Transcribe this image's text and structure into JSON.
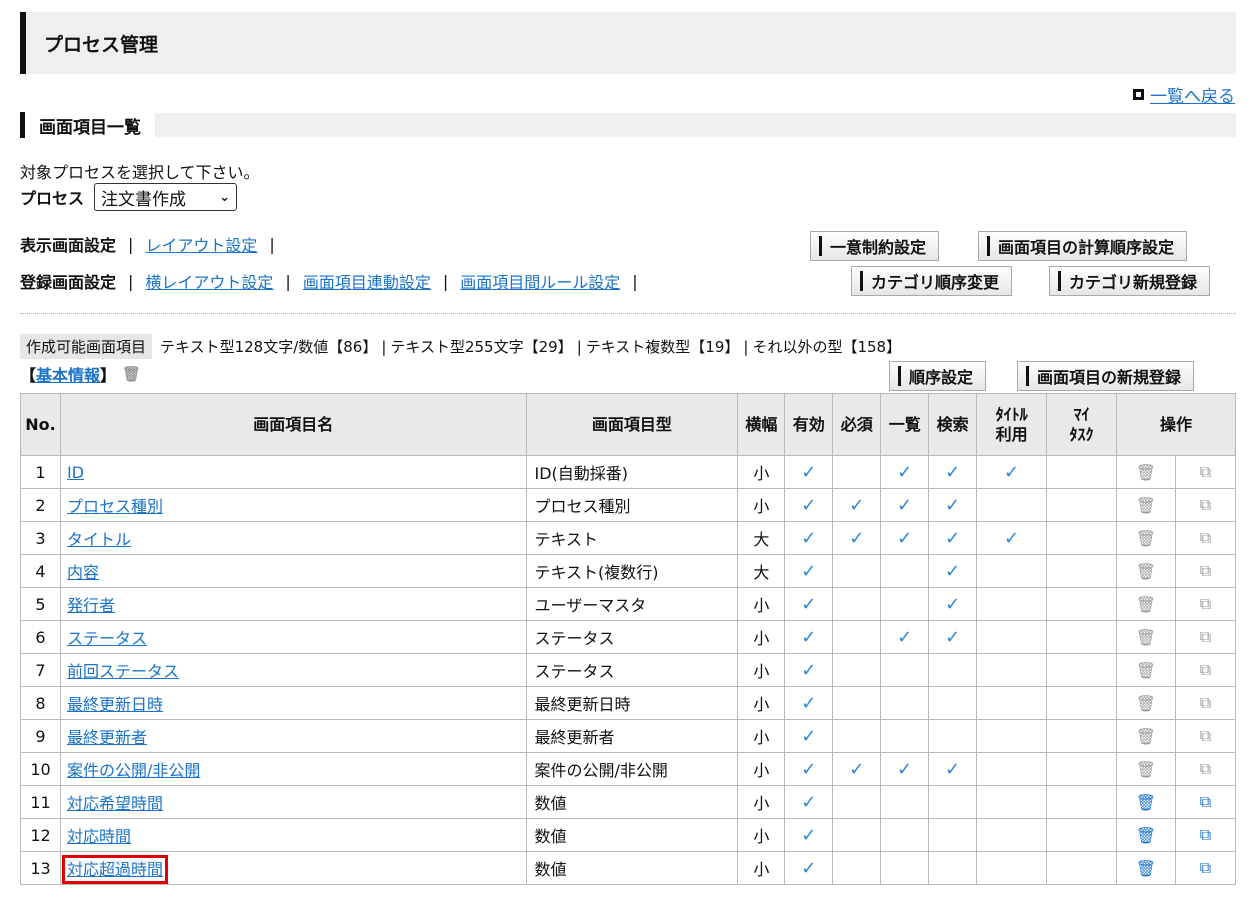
{
  "header": {
    "title": "プロセス管理"
  },
  "back_link": "一覧へ戻る",
  "section": {
    "title": "画面項目一覧"
  },
  "instruction": "対象プロセスを選択して下さい。",
  "process": {
    "label": "プロセス",
    "selected": "注文書作成"
  },
  "display_settings": {
    "label": "表示画面設定",
    "links": [
      "レイアウト設定"
    ]
  },
  "register_settings": {
    "label": "登録画面設定",
    "links": [
      "横レイアウト設定",
      "画面項目連動設定",
      "画面項目間ルール設定"
    ]
  },
  "separator": "|",
  "buttons": {
    "unique": "一意制約設定",
    "calc_order": "画面項目の計算順序設定",
    "cat_order": "カテゴリ順序変更",
    "cat_new": "カテゴリ新規登録",
    "order": "順序設定",
    "item_new": "画面項目の新規登録"
  },
  "counts": {
    "label": "作成可能画面項目",
    "items": [
      "テキスト型128文字/数値【86】",
      "テキスト型255文字【29】",
      "テキスト複数型【19】",
      "それ以外の型【158】"
    ]
  },
  "category": {
    "open": "【",
    "name": "基本情報",
    "close": "】"
  },
  "table": {
    "headers": {
      "no": "No.",
      "name": "画面項目名",
      "type": "画面項目型",
      "width": "横幅",
      "valid": "有効",
      "required": "必須",
      "list": "一覧",
      "search": "検索",
      "title1": "ﾀｲﾄﾙ",
      "title2": "利用",
      "my1": "ﾏｲ",
      "my2": "ﾀｽｸ",
      "ops": "操作"
    },
    "check_mark": "✓",
    "trash_icon": "trash-icon",
    "copy_icon": "copy-icon",
    "rows": [
      {
        "no": "1",
        "name": "ID",
        "type": "ID(自動採番)",
        "width": "小",
        "valid": true,
        "required": false,
        "list": true,
        "search": true,
        "title": true,
        "ops_active": false
      },
      {
        "no": "2",
        "name": "プロセス種別",
        "type": "プロセス種別",
        "width": "小",
        "valid": true,
        "required": true,
        "list": true,
        "search": true,
        "title": false,
        "ops_active": false
      },
      {
        "no": "3",
        "name": "タイトル",
        "type": "テキスト",
        "width": "大",
        "valid": true,
        "required": true,
        "list": true,
        "search": true,
        "title": true,
        "ops_active": false
      },
      {
        "no": "4",
        "name": "内容",
        "type": "テキスト(複数行)",
        "width": "大",
        "valid": true,
        "required": false,
        "list": false,
        "search": true,
        "title": false,
        "ops_active": false
      },
      {
        "no": "5",
        "name": "発行者",
        "type": "ユーザーマスタ",
        "width": "小",
        "valid": true,
        "required": false,
        "list": false,
        "search": true,
        "title": false,
        "ops_active": false
      },
      {
        "no": "6",
        "name": "ステータス",
        "type": "ステータス",
        "width": "小",
        "valid": true,
        "required": false,
        "list": true,
        "search": true,
        "title": false,
        "ops_active": false
      },
      {
        "no": "7",
        "name": "前回ステータス",
        "type": "ステータス",
        "width": "小",
        "valid": true,
        "required": false,
        "list": false,
        "search": false,
        "title": false,
        "ops_active": false
      },
      {
        "no": "8",
        "name": "最終更新日時",
        "type": "最終更新日時",
        "width": "小",
        "valid": true,
        "required": false,
        "list": false,
        "search": false,
        "title": false,
        "ops_active": false
      },
      {
        "no": "9",
        "name": "最終更新者",
        "type": "最終更新者",
        "width": "小",
        "valid": true,
        "required": false,
        "list": false,
        "search": false,
        "title": false,
        "ops_active": false
      },
      {
        "no": "10",
        "name": "案件の公開/非公開",
        "type": "案件の公開/非公開",
        "width": "小",
        "valid": true,
        "required": true,
        "list": true,
        "search": true,
        "title": false,
        "ops_active": false
      },
      {
        "no": "11",
        "name": "対応希望時間",
        "type": "数値",
        "width": "小",
        "valid": true,
        "required": false,
        "list": false,
        "search": false,
        "title": false,
        "ops_active": true
      },
      {
        "no": "12",
        "name": "対応時間",
        "type": "数値",
        "width": "小",
        "valid": true,
        "required": false,
        "list": false,
        "search": false,
        "title": false,
        "ops_active": true
      },
      {
        "no": "13",
        "name": "対応超過時間",
        "type": "数値",
        "width": "小",
        "valid": true,
        "required": false,
        "list": false,
        "search": false,
        "title": false,
        "ops_active": true,
        "highlighted": true
      }
    ]
  }
}
